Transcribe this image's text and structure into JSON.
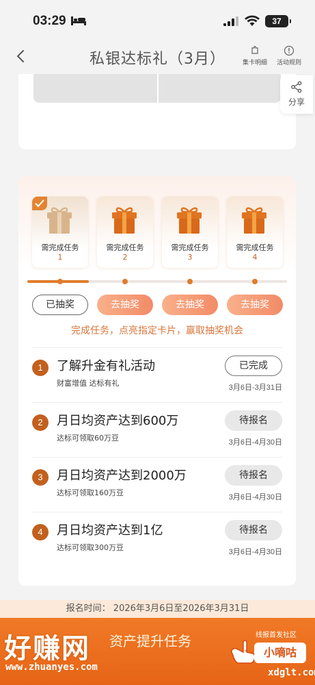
{
  "status": {
    "time": "03:29",
    "battery": "37"
  },
  "nav": {
    "title": "私银达标礼（3月）",
    "card_detail": "集卡明细",
    "rules": "活动规则"
  },
  "share": {
    "label": "分享"
  },
  "gifts": [
    {
      "label": "需完成任务",
      "num": "1",
      "done": true
    },
    {
      "label": "需完成任务",
      "num": "2",
      "done": false
    },
    {
      "label": "需完成任务",
      "num": "3",
      "done": false
    },
    {
      "label": "需完成任务",
      "num": "4",
      "done": false
    }
  ],
  "progress": 0.25,
  "draw_buttons": [
    "已抽奖",
    "去抽奖",
    "去抽奖",
    "去抽奖"
  ],
  "hint": "完成任务，点亮指定卡片，赢取抽奖机会",
  "tasks": [
    {
      "num": "1",
      "title": "了解升金有礼活动",
      "sub": "财富增值 达标有礼",
      "button": "已完成",
      "date": "3月6日-3月31日"
    },
    {
      "num": "2",
      "title": "月日均资产达到600万",
      "sub": "达标可领取60万豆",
      "button": "待报名",
      "date": "3月6日-4月30日"
    },
    {
      "num": "3",
      "title": "月日均资产达到2000万",
      "sub": "达标可领取160万豆",
      "button": "待报名",
      "date": "3月6日-4月30日"
    },
    {
      "num": "4",
      "title": "月日均资产达到1亿",
      "sub": "达标可领取300万豆",
      "button": "待报名",
      "date": "3月6日-4月30日"
    }
  ],
  "registration": "报名时间： 2026年3月6日至2026年3月31日",
  "banner": {
    "title": "资产提升任务",
    "tag_small": "线报首发社区",
    "tag_big": "小嘀咕"
  },
  "watermark": {
    "brand": "好赚网",
    "url": "www.zhuanyes.com",
    "right": "xdglt.com"
  },
  "colors": {
    "accent": "#e07c2c",
    "badge": "#c2601e",
    "pill": "#f28b67"
  }
}
